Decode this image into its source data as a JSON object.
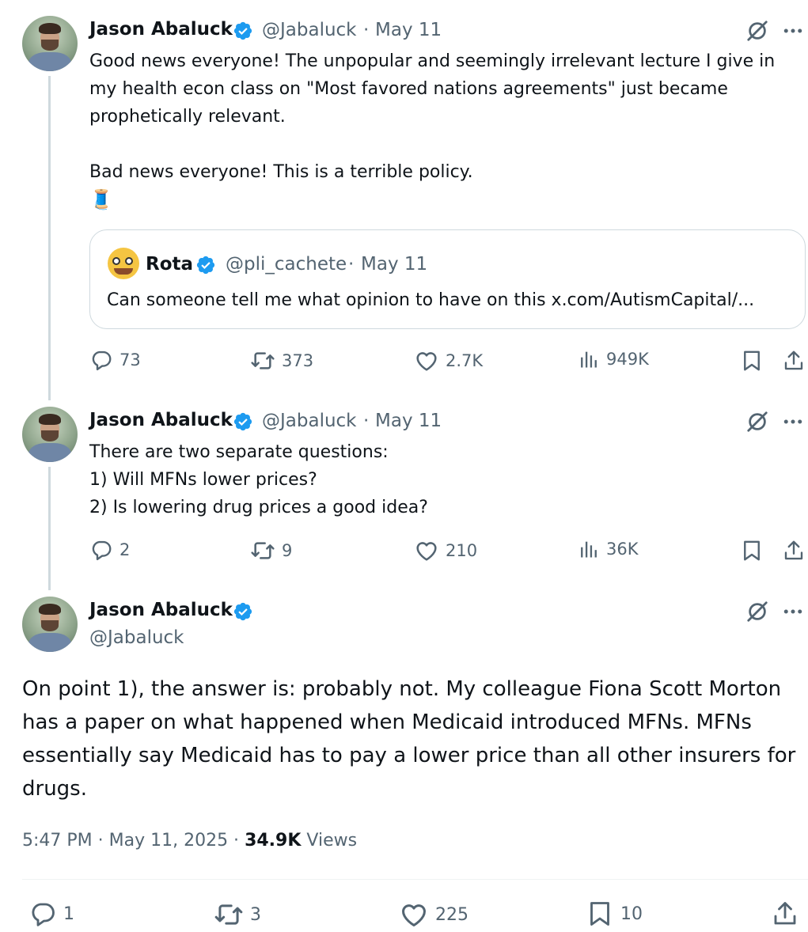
{
  "tweet1": {
    "author_name": "Jason Abaluck",
    "handle": "@Jabaluck",
    "date": "May 11",
    "text": "Good news everyone! The unpopular and seemingly irrelevant lecture I give in\nmy health econ class on \"Most favored nations agreements\" just became\nprophetically relevant.\n\nBad news everyone! This is a terrible policy.",
    "thread_emoji": "🧵",
    "quote": {
      "author_name": "Rota",
      "handle": "@pli_cachete",
      "date": "May 11",
      "text": "Can someone tell me what opinion to have on this x.com/AutismCapital/..."
    },
    "stats": {
      "replies": "73",
      "reposts": "373",
      "likes": "2.7K",
      "views": "949K"
    }
  },
  "tweet2": {
    "author_name": "Jason Abaluck",
    "handle": "@Jabaluck",
    "date": "May 11",
    "text": "There are two separate questions:\n1) Will MFNs lower prices?\n2) Is lowering drug prices a good idea?",
    "stats": {
      "replies": "2",
      "reposts": "9",
      "likes": "210",
      "views": "36K"
    }
  },
  "main_tweet": {
    "author_name": "Jason Abaluck",
    "handle": "@Jabaluck",
    "text": "On point 1), the answer is: probably not. My colleague  Fiona Scott Morton has a paper on what happened when Medicaid introduced MFNs. MFNs essentially say Medicaid has to pay a lower price than all other insurers for drugs.",
    "time": "5:47 PM · May 11, 2025 · ",
    "views_count": "34.9K",
    "views_label": " Views",
    "stats": {
      "replies": "1",
      "reposts": "3",
      "likes": "225",
      "bookmarks": "10"
    }
  },
  "icons": {
    "verified": "verified-badge-icon",
    "grok": "grok-icon",
    "more": "more-icon",
    "reply": "reply-icon",
    "repost": "repost-icon",
    "like": "like-icon",
    "views": "views-icon",
    "bookmark": "bookmark-icon",
    "share": "share-icon"
  },
  "colors": {
    "text": "#0f1419",
    "secondary": "#536471",
    "verified": "#1d9bf0",
    "border": "#cfd9de"
  }
}
